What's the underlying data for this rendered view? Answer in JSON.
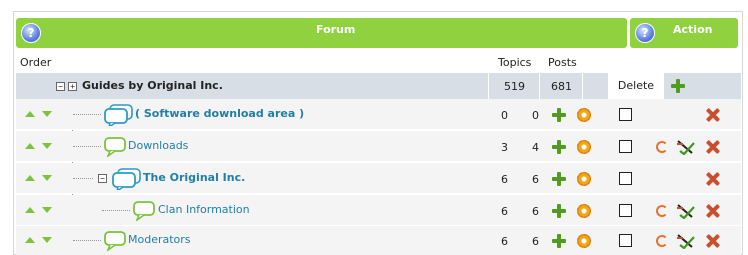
{
  "header": {
    "forum_title": "Forum",
    "action_title": "Action",
    "help_icon_label": "?"
  },
  "columns": {
    "order": "Order",
    "topics": "Topics",
    "posts": "Posts",
    "delete": "Delete"
  },
  "category": {
    "name": "Guides by Original Inc.",
    "topics": "519",
    "posts": "681"
  },
  "rows": [
    {
      "name": "( Software download area )",
      "topics": "0",
      "posts": "0"
    },
    {
      "name": "Downloads",
      "topics": "3",
      "posts": "4"
    },
    {
      "name": "The Original Inc.",
      "topics": "6",
      "posts": "6"
    },
    {
      "name": "Clan Information",
      "topics": "6",
      "posts": "6"
    },
    {
      "name": "Moderators",
      "topics": "6",
      "posts": "6"
    }
  ],
  "colors": {
    "accent_green": "#8fd13f",
    "link_blue": "#1f7fa6",
    "delete_red": "#c9502e"
  }
}
